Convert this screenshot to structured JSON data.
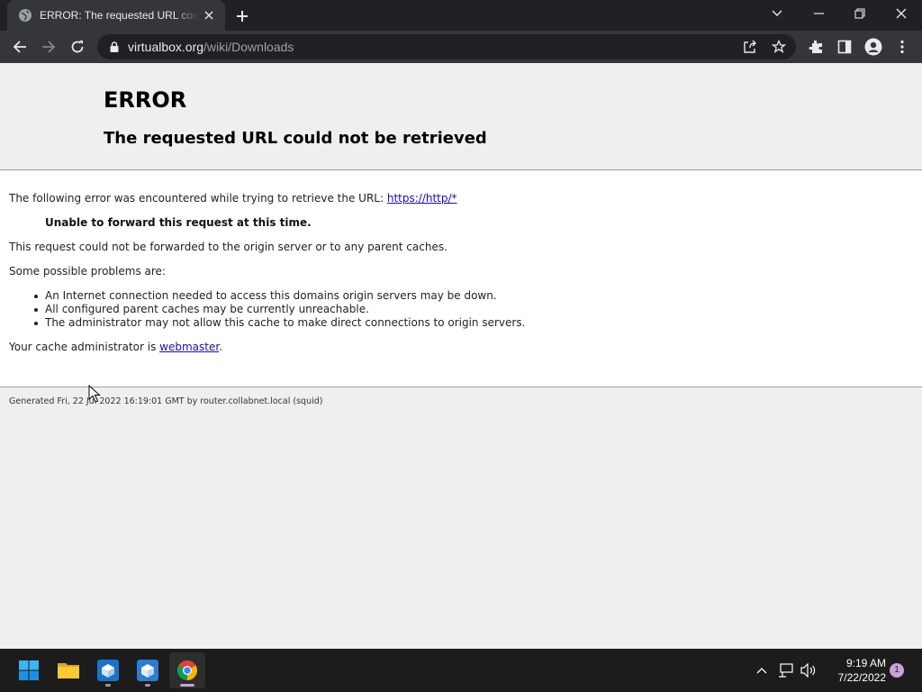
{
  "browser": {
    "tab": {
      "title": "ERROR: The requested URL could not be retrieved",
      "favicon": "globe-icon"
    },
    "new_tab_icon": "plus-icon",
    "window_controls": [
      "chevron-down-icon",
      "minimize-icon",
      "restore-icon",
      "close-icon"
    ],
    "omnibox": {
      "host": "virtualbox.org",
      "path": "/wiki/Downloads",
      "icons": [
        "share-icon",
        "star-icon"
      ]
    },
    "toolbar_icons": [
      "back-icon",
      "forward-icon",
      "reload-icon",
      "extensions-icon",
      "side-panel-icon",
      "profile-icon",
      "menu-icon"
    ]
  },
  "page": {
    "heading": "ERROR",
    "subheading": "The requested URL could not be retrieved",
    "intro": "The following error was encountered while trying to retrieve the URL: ",
    "url_link": "https://http/*",
    "error_title": "Unable to forward this request at this time.",
    "description": "This request could not be forwarded to the origin server or to any parent caches.",
    "problems_intro": "Some possible problems are:",
    "problems": [
      "An Internet connection needed to access this domains origin servers may be down.",
      "All configured parent caches may be currently unreachable.",
      "The administrator may not allow this cache to make direct connections to origin servers."
    ],
    "admin_prefix": "Your cache administrator is ",
    "admin_link": "webmaster",
    "admin_suffix": ".",
    "footer": "Generated Fri, 22 Jul 2022 16:19:01 GMT by router.collabnet.local (squid)"
  },
  "taskbar": {
    "apps": [
      "windows-start-icon",
      "file-explorer-icon",
      "virtualbox-icon",
      "virtualbox-manager-icon",
      "chrome-icon"
    ],
    "tray": [
      "chevron-up-icon",
      "network-icon",
      "volume-icon"
    ],
    "time": "9:19 AM",
    "date": "7/22/2022",
    "notification_count": "1"
  },
  "colors": {
    "accent_link": "#1a0dab",
    "taskbar_bg": "#1c1c1c",
    "chrome_dark": "#35363a"
  }
}
